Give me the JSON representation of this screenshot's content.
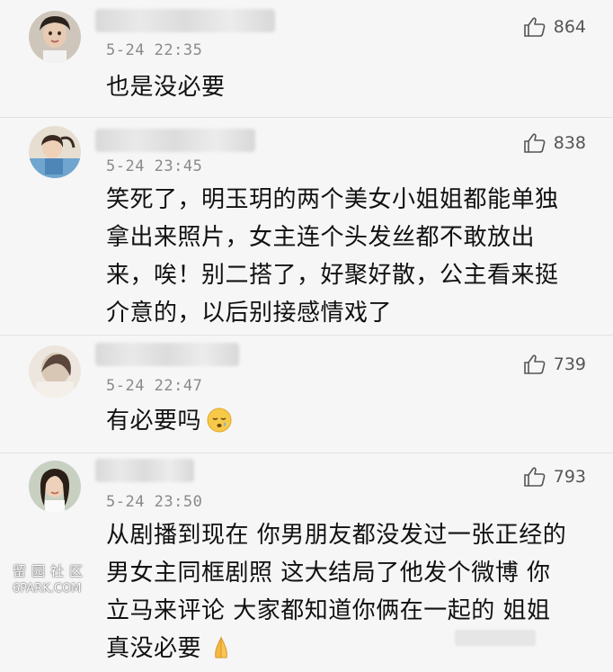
{
  "comments": [
    {
      "time": "5-24 22:35",
      "likes": "864",
      "lines": [
        "也是没必要"
      ]
    },
    {
      "time": "5-24 23:45",
      "likes": "838",
      "lines": [
        "笑死了，明玉玥的两个美女小姐姐都能单独",
        "拿出来照片，女主连个头发丝都不敢放出",
        "来，唉！别二搭了，好聚好散，公主看来挺",
        "介意的，以后别接感情戏了"
      ]
    },
    {
      "time": "5-24 22:47",
      "likes": "739",
      "lines": [
        "有必要吗"
      ],
      "emoji": "sleepy-face-emoji"
    },
    {
      "time": "5-24 23:50",
      "likes": "793",
      "lines": [
        "从剧播到现在 你男朋友都没发过一张正经的",
        "男女主同框剧照 这大结局了他发个微博 你",
        "立马来评论 大家都知道你俩在一起的 姐姐",
        "真没必要"
      ],
      "emoji": "pray-emoji"
    }
  ],
  "watermark": {
    "cn": "留园社区",
    "en": "6PARK.COM"
  },
  "icons": {
    "like": "thumbs-up-icon"
  },
  "colors": {
    "background": "#f6f6f6",
    "text": "#111111",
    "meta": "#8a8a8a"
  }
}
